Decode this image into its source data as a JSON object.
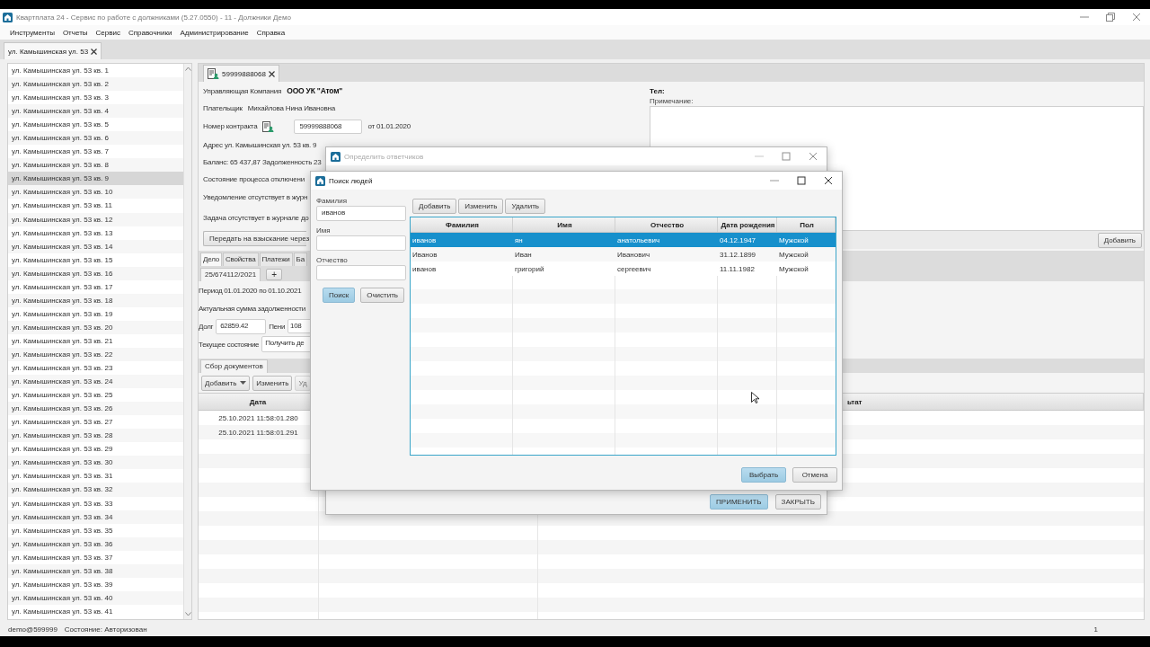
{
  "window": {
    "title": "Квартплата 24 - Сервис по работе с должниками (5.27.0550) - 11 - Должники Демо"
  },
  "menu": [
    "Инструменты",
    "Отчеты",
    "Сервис",
    "Справочники",
    "Администрирование",
    "Справка"
  ],
  "document_tabs": [
    {
      "label": "ул. Камышинская ул. 53",
      "selected": true
    }
  ],
  "apartments": [
    {
      "label": "ул. Камышинская ул. 53 кв. 1",
      "selected": false
    },
    {
      "label": "ул. Камышинская ул. 53 кв. 2",
      "selected": false
    },
    {
      "label": "ул. Камышинская ул. 53 кв. 3",
      "selected": false
    },
    {
      "label": "ул. Камышинская ул. 53 кв. 4",
      "selected": false
    },
    {
      "label": "ул. Камышинская ул. 53 кв. 5",
      "selected": false
    },
    {
      "label": "ул. Камышинская ул. 53 кв. 6",
      "selected": false
    },
    {
      "label": "ул. Камышинская ул. 53 кв. 7",
      "selected": false
    },
    {
      "label": "ул. Камышинская ул. 53 кв. 8",
      "selected": false
    },
    {
      "label": "ул. Камышинская ул. 53 кв. 9",
      "selected": true
    },
    {
      "label": "ул. Камышинская ул. 53 кв. 10",
      "selected": false
    },
    {
      "label": "ул. Камышинская ул. 53 кв. 11",
      "selected": false
    },
    {
      "label": "ул. Камышинская ул. 53 кв. 12",
      "selected": false
    },
    {
      "label": "ул. Камышинская ул. 53 кв. 13",
      "selected": false
    },
    {
      "label": "ул. Камышинская ул. 53 кв. 14",
      "selected": false
    },
    {
      "label": "ул. Камышинская ул. 53 кв. 15",
      "selected": false
    },
    {
      "label": "ул. Камышинская ул. 53 кв. 16",
      "selected": false
    },
    {
      "label": "ул. Камышинская ул. 53 кв. 17",
      "selected": false
    },
    {
      "label": "ул. Камышинская ул. 53 кв. 18",
      "selected": false
    },
    {
      "label": "ул. Камышинская ул. 53 кв. 19",
      "selected": false
    },
    {
      "label": "ул. Камышинская ул. 53 кв. 20",
      "selected": false
    },
    {
      "label": "ул. Камышинская ул. 53 кв. 21",
      "selected": false
    },
    {
      "label": "ул. Камышинская ул. 53 кв. 22",
      "selected": false
    },
    {
      "label": "ул. Камышинская ул. 53 кв. 23",
      "selected": false
    },
    {
      "label": "ул. Камышинская ул. 53 кв. 24",
      "selected": false
    },
    {
      "label": "ул. Камышинская ул. 53 кв. 25",
      "selected": false
    },
    {
      "label": "ул. Камышинская ул. 53 кв. 26",
      "selected": false
    },
    {
      "label": "ул. Камышинская ул. 53 кв. 27",
      "selected": false
    },
    {
      "label": "ул. Камышинская ул. 53 кв. 28",
      "selected": false
    },
    {
      "label": "ул. Камышинская ул. 53 кв. 29",
      "selected": false
    },
    {
      "label": "ул. Камышинская ул. 53 кв. 30",
      "selected": false
    },
    {
      "label": "ул. Камышинская ул. 53 кв. 31",
      "selected": false
    },
    {
      "label": "ул. Камышинская ул. 53 кв. 32",
      "selected": false
    },
    {
      "label": "ул. Камышинская ул. 53 кв. 33",
      "selected": false
    },
    {
      "label": "ул. Камышинская ул. 53 кв. 34",
      "selected": false
    },
    {
      "label": "ул. Камышинская ул. 53 кв. 35",
      "selected": false
    },
    {
      "label": "ул. Камышинская ул. 53 кв. 36",
      "selected": false
    },
    {
      "label": "ул. Камышинская ул. 53 кв. 37",
      "selected": false
    },
    {
      "label": "ул. Камышинская ул. 53 кв. 38",
      "selected": false
    },
    {
      "label": "ул. Камышинская ул. 53 кв. 39",
      "selected": false
    },
    {
      "label": "ул. Камышинская ул. 53 кв. 40",
      "selected": false
    },
    {
      "label": "ул. Камышинская ул. 53 кв. 41",
      "selected": false
    }
  ],
  "contract_tab": {
    "label": "59999888068"
  },
  "form": {
    "company_label": "Управляющая Компания",
    "company": "ООО УК \"Атом\"",
    "payer_label": "Плательщик",
    "payer": "Михайлова Нина Ивановна",
    "contract_label": "Номер контракта",
    "contract_number": "59999888068",
    "contract_date": "от 01.01.2020",
    "address": "Адрес  ул. Камышинская ул. 53 кв. 9",
    "balance": "Баланс: 65 437,87  Задолженность  23",
    "lines": [
      "Состояние процесса отключени",
      "Уведомление отсутствует в журн",
      "Задача отсутствует в журнале до"
    ],
    "transfer_button": "Передать на взыскание через"
  },
  "contacts": {
    "phone_label": "Тел:",
    "note_label": "Примечание:",
    "add_button": "Добавить"
  },
  "case_tabs": [
    {
      "label": "Дело",
      "selected": true
    },
    {
      "label": "Свойства",
      "selected": false
    },
    {
      "label": "Платежи",
      "selected": false
    },
    {
      "label": "Ба",
      "selected": false
    }
  ],
  "case": {
    "number": "25/674112/2021",
    "add_button": "+",
    "period": "Период 01.01.2020 по 01.10.2021",
    "total_label": "Актуальная сумма задолженности",
    "debt_label": "Долг",
    "debt": "62859.42",
    "penalty_label": "Пени",
    "penalty": "108",
    "state_label": "Текущее состояние",
    "state": "Получить де"
  },
  "documents": {
    "tab": "Сбор документов",
    "toolbar": [
      {
        "label": "Добавить",
        "kind": "menu",
        "disabled": false
      },
      {
        "label": "Изменить",
        "kind": "button",
        "disabled": false
      },
      {
        "label": "Уд",
        "kind": "button",
        "disabled": true
      }
    ],
    "columns": [
      "Дата",
      "ьтат"
    ],
    "rows": [
      [
        "25.10.2021 11:58:01.280"
      ],
      [
        "25.10.2021 11:58:01.291"
      ]
    ]
  },
  "respondents_dialog": {
    "title": "Определить ответчиков",
    "buttons": [
      {
        "label": "ПРИМЕНИТЬ",
        "default": true
      },
      {
        "label": "ЗАКРЫТЬ",
        "default": false
      }
    ]
  },
  "search_dialog": {
    "title": "Поиск людей",
    "fields": [
      {
        "label": "Фамилия",
        "value": "иванов"
      },
      {
        "label": "Имя"
      },
      {
        "label": "Отчество"
      }
    ],
    "search_buttons": [
      {
        "label": "Поиск",
        "default": true
      },
      {
        "label": "Очистить",
        "default": false
      }
    ],
    "toolbar": [
      "Добавить",
      "Изменить",
      "Удалить"
    ],
    "columns": [
      "Фамилия",
      "Имя",
      "Отчество",
      "Дата рождения",
      "Пол"
    ],
    "rows": [
      {
        "cells": [
          "иванов",
          "ян",
          "анатольевич",
          "04.12.1947",
          "Мужской"
        ],
        "selected": true
      },
      {
        "cells": [
          "Иванов",
          "Иван",
          "Иванович",
          "31.12.1899",
          "Мужской"
        ],
        "selected": false
      },
      {
        "cells": [
          "иванов",
          "григорий",
          "сергеевич",
          "11.11.1982",
          "Мужской"
        ],
        "selected": false
      }
    ],
    "buttons": [
      {
        "label": "Выбрать",
        "default": true
      },
      {
        "label": "Отмена",
        "default": false
      }
    ]
  },
  "status_bar": {
    "user": "demo@599999",
    "state": "Состояние: Авторизован",
    "page": "1"
  }
}
